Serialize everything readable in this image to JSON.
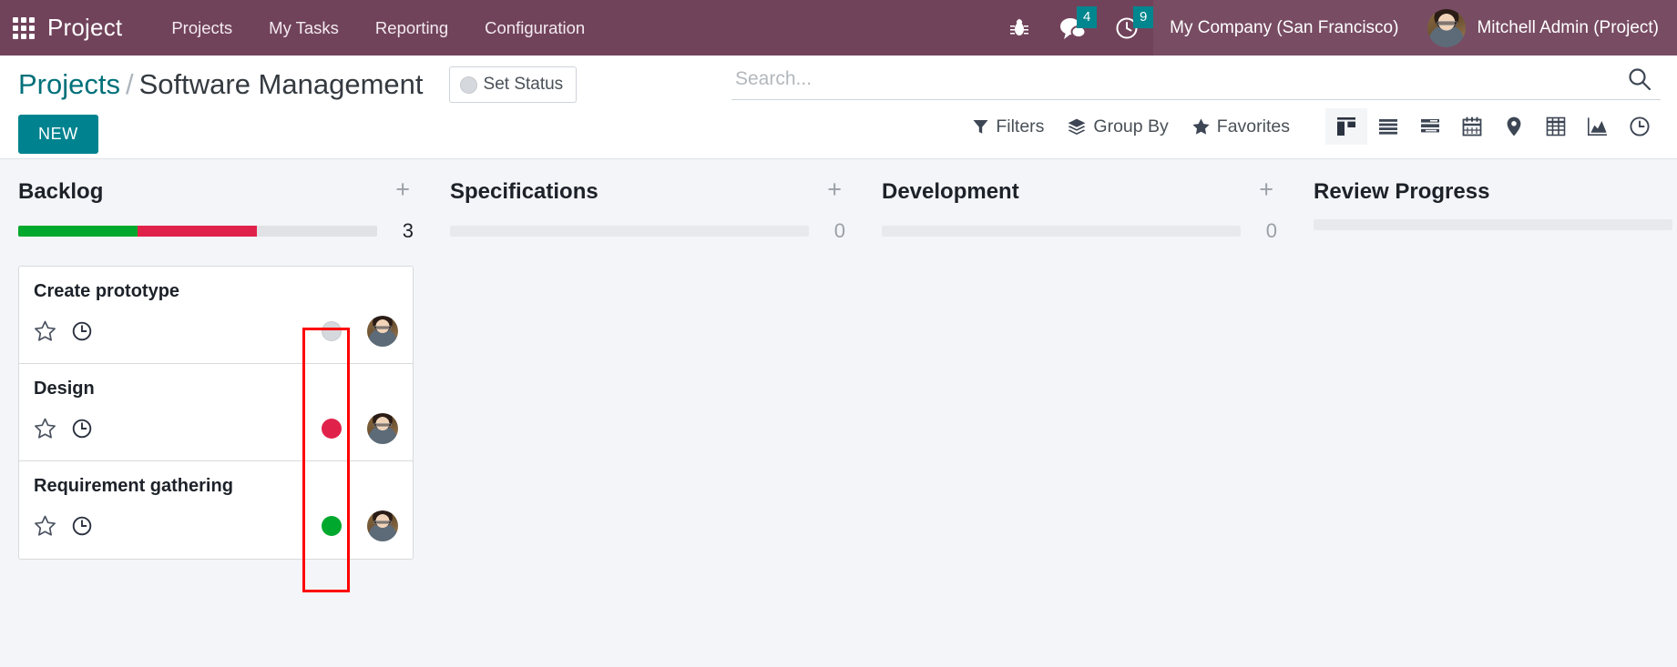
{
  "navbar": {
    "apps_icon": "apps-grid-icon",
    "brand": "Project",
    "menu": [
      {
        "label": "Projects"
      },
      {
        "label": "My Tasks"
      },
      {
        "label": "Reporting"
      },
      {
        "label": "Configuration"
      }
    ],
    "sys_icons": [
      {
        "name": "bug-icon",
        "badge": null
      },
      {
        "name": "messages-icon",
        "badge": "4"
      },
      {
        "name": "activities-clock-icon",
        "badge": "9"
      }
    ],
    "company": "My Company (San Francisco)",
    "user": "Mitchell Admin (Project)",
    "bg_color": "#71435B",
    "badge_color": "#00868e"
  },
  "control_panel": {
    "breadcrumb": {
      "parent": "Projects",
      "separator": "/",
      "current": "Software Management"
    },
    "set_status_label": "Set Status",
    "new_label": "NEW",
    "search": {
      "value": "",
      "placeholder": "Search..."
    },
    "tools": [
      {
        "name": "filters-button",
        "icon": "funnel-icon",
        "label": "Filters"
      },
      {
        "name": "group-by-button",
        "icon": "layers-icon",
        "label": "Group By"
      },
      {
        "name": "favorites-button",
        "icon": "star-icon",
        "label": "Favorites"
      }
    ],
    "views": [
      {
        "name": "kanban-view-button",
        "icon": "kanban-icon",
        "active": true
      },
      {
        "name": "list-view-button",
        "icon": "list-icon",
        "active": false
      },
      {
        "name": "gantt-view-button",
        "icon": "gantt-icon",
        "active": false
      },
      {
        "name": "calendar-view-button",
        "icon": "calendar-icon",
        "active": false
      },
      {
        "name": "map-view-button",
        "icon": "map-pin-icon",
        "active": false
      },
      {
        "name": "pivot-view-button",
        "icon": "pivot-table-icon",
        "active": false
      },
      {
        "name": "graph-view-button",
        "icon": "graph-area-icon",
        "active": false
      },
      {
        "name": "activity-view-button",
        "icon": "clock-icon",
        "active": false
      }
    ]
  },
  "kanban": {
    "columns": [
      {
        "title": "Backlog",
        "count": "3",
        "add_label": "+",
        "progress": [
          {
            "state": "done",
            "color": "#00a82d",
            "pct": 33.3
          },
          {
            "state": "blocked",
            "color": "#e0224b",
            "pct": 33.3
          },
          {
            "state": "normal",
            "color": "#e0e2e6",
            "pct": 33.4
          }
        ],
        "cards": [
          {
            "title": "Create prototype",
            "state": "gray",
            "state_color": "#d5d8dc",
            "star": "star-outline-icon",
            "clock": "clock-icon",
            "assignee": "Mitchell Admin"
          },
          {
            "title": "Design",
            "state": "red",
            "state_color": "#e0224b",
            "star": "star-outline-icon",
            "clock": "clock-icon",
            "assignee": "Mitchell Admin"
          },
          {
            "title": "Requirement gathering",
            "state": "green",
            "state_color": "#00a82d",
            "star": "star-outline-icon",
            "clock": "clock-icon",
            "assignee": "Mitchell Admin"
          }
        ]
      },
      {
        "title": "Specifications",
        "count": "0",
        "add_label": "+",
        "progress": [
          {
            "state": "empty",
            "color": "#e7e9ec",
            "pct": 100
          }
        ],
        "cards": []
      },
      {
        "title": "Development",
        "count": "0",
        "add_label": "+",
        "progress": [
          {
            "state": "empty",
            "color": "#e7e9ec",
            "pct": 100
          }
        ],
        "cards": []
      },
      {
        "title": "Review Progress",
        "count": "",
        "add_label": "",
        "progress": [
          {
            "state": "empty",
            "color": "#e7e9ec",
            "pct": 100
          }
        ],
        "cards": []
      }
    ]
  },
  "annotation": {
    "name": "highlight-rectangle-task-state-column",
    "color": "#ff0000"
  }
}
